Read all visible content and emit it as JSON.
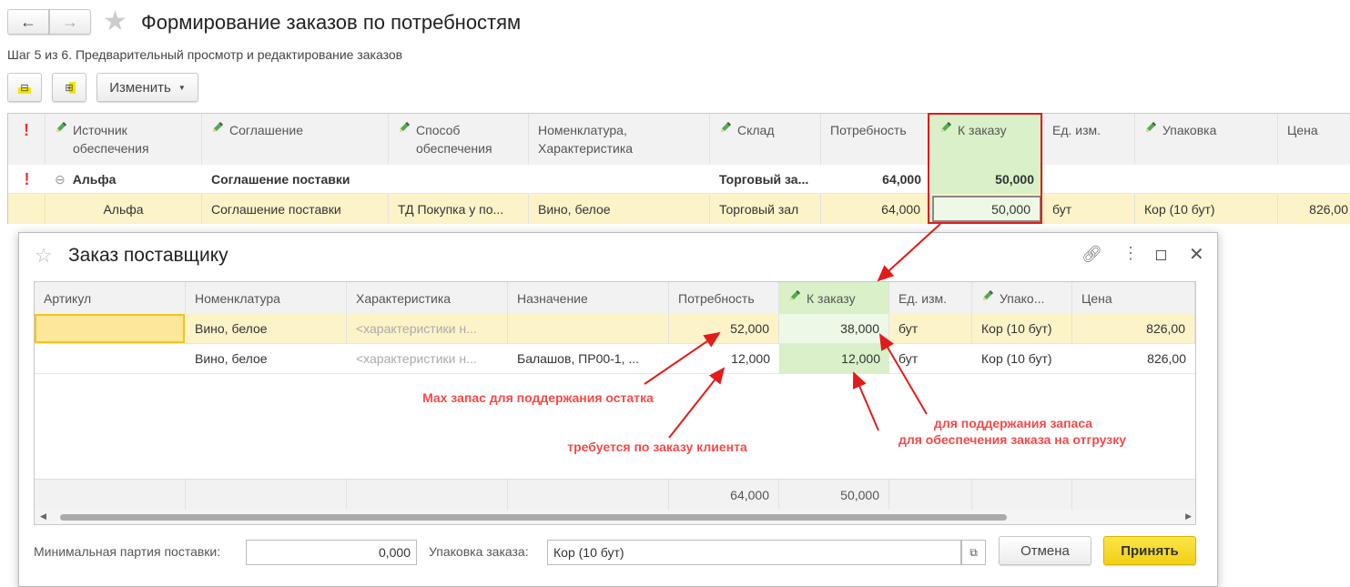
{
  "window": {
    "title": "Формирование заказов по потребностям",
    "step": "Шаг 5 из 6. Предварительный просмотр и редактирование заказов"
  },
  "toolbar": {
    "change_label": "Изменить"
  },
  "main_table": {
    "columns": [
      "Источник обеспечения",
      "Соглашение",
      "Способ обеспечения",
      "Номенклатура, Характеристика",
      "Склад",
      "Потребность",
      "К заказу",
      "Ед. изм.",
      "Упаковка",
      "Цена"
    ],
    "group_row": {
      "source": "Альфа",
      "agreement": "Соглашение поставки",
      "warehouse": "Торговый за...",
      "need": "64,000",
      "to_order": "50,000"
    },
    "row": {
      "source": "Альфа",
      "agreement": "Соглашение поставки",
      "method": "ТД Покупка у по...",
      "item": "Вино, белое",
      "warehouse": "Торговый зал",
      "need": "64,000",
      "to_order": "50,000",
      "unit": "бут",
      "package": "Кор (10 бут)",
      "price": "826,00"
    }
  },
  "dialog": {
    "title": "Заказ поставщику",
    "columns": [
      "Артикул",
      "Номенклатура",
      "Характеристика",
      "Назначение",
      "Потребность",
      "К заказу",
      "Ед. изм.",
      "Упако...",
      "Цена"
    ],
    "rows": [
      {
        "article": "",
        "item": "Вино, белое",
        "char": "<характеристики н...",
        "purpose": "",
        "need": "52,000",
        "to_order": "38,000",
        "unit": "бут",
        "package": "Кор (10 бут)",
        "price": "826,00"
      },
      {
        "article": "",
        "item": "Вино, белое",
        "char": "<характеристики н...",
        "purpose": "Балашов, ПР00-1, ...",
        "need": "12,000",
        "to_order": "12,000",
        "unit": "бут",
        "package": "Кор (10 бут)",
        "price": "826,00"
      }
    ],
    "totals": {
      "need": "64,000",
      "to_order": "50,000"
    },
    "min_batch_label": "Минимальная партия поставки:",
    "min_batch_value": "0,000",
    "package_label": "Упаковка заказа:",
    "package_value": "Кор (10 бут)",
    "cancel": "Отмена",
    "accept": "Принять"
  },
  "annotations": {
    "max_stock": "Max запас для поддержания остатка",
    "client_order": "требуется по заказу клиента",
    "keep_stock": "для поддержания запаса",
    "shipment": "для обеспечения заказа на отгрузку"
  },
  "colors": {
    "accent": "#f24b4b",
    "selected_row": "#fdf3c9",
    "edit_col": "#d9f0c8",
    "accept": "#f7d82b"
  }
}
